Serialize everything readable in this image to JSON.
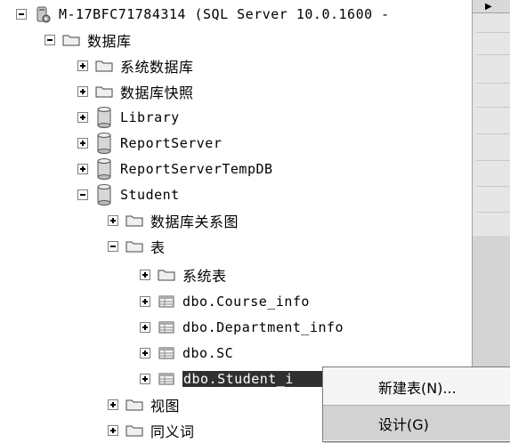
{
  "tree": {
    "server": "M-17BFC71784314 (SQL Server 10.0.1600 -",
    "databases_folder": "数据库",
    "system_databases": "系统数据库",
    "snapshots": "数据库快照",
    "db_library": "Library",
    "db_reportserver": "ReportServer",
    "db_reportservertemp": "ReportServerTempDB",
    "db_student": "Student",
    "diagrams": "数据库关系图",
    "tables_folder": "表",
    "system_tables": "系统表",
    "table_course": "dbo.Course_info",
    "table_department": "dbo.Department_info",
    "table_sc": "dbo.SC",
    "table_student": "dbo.Student_i",
    "views": "视图",
    "synonyms": "同义词"
  },
  "context_menu": {
    "new_table": "新建表(N)...",
    "design": "设计(G)"
  }
}
